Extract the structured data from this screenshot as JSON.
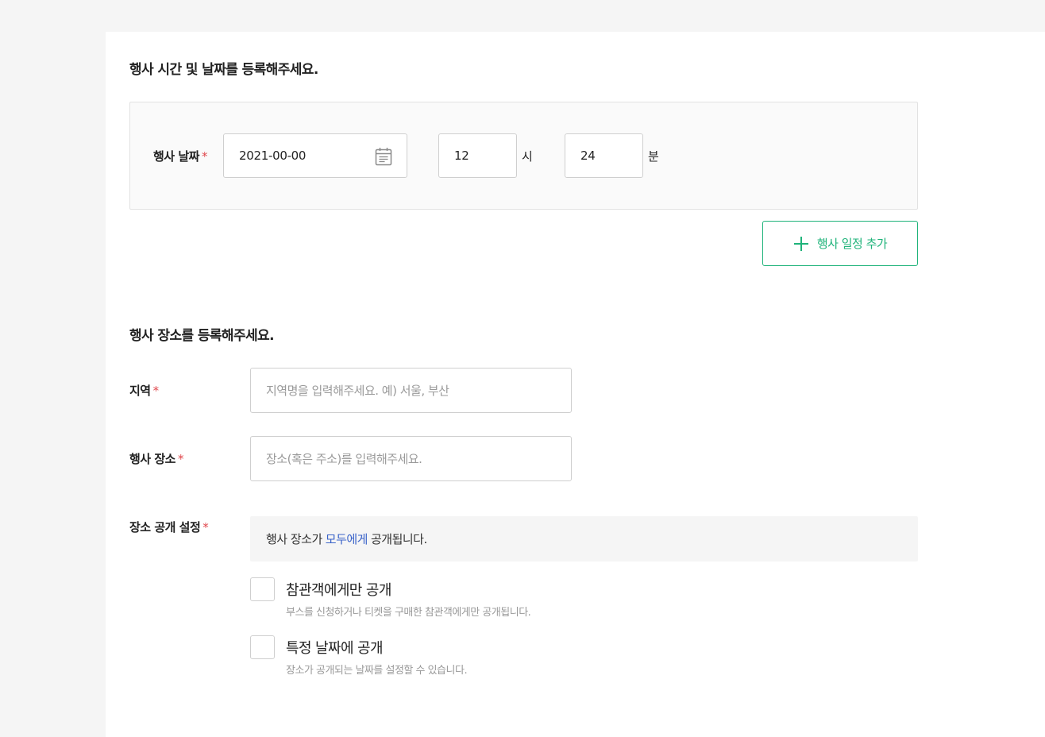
{
  "schedule": {
    "title": "행사 시간 및 날짜를 등록해주세요.",
    "date_label": "행사 날짜",
    "required_mark": "*",
    "date_value": "2021-00-00",
    "hour_value": "12",
    "hour_unit": "시",
    "minute_value": "24",
    "minute_unit": "분",
    "add_button_label": "행사 일정 추가"
  },
  "venue": {
    "title": "행사 장소를 등록해주세요.",
    "region_label": "지역",
    "region_placeholder": "지역명을 입력해주세요. 예) 서울, 부산",
    "place_label": "행사 장소",
    "place_placeholder": "장소(혹은 주소)를 입력해주세요.",
    "visibility_label": "장소 공개 설정",
    "notice_prefix": "행사 장소가",
    "notice_highlight": "모두에게",
    "notice_suffix": "공개됩니다.",
    "options": [
      {
        "title": "참관객에게만 공개",
        "desc": "부스를 신청하거나 티켓을 구매한 참관객에게만 공개됩니다.",
        "checked": false
      },
      {
        "title": "특정 날짜에 공개",
        "desc": "장소가 공개되는 날짜를 설정할 수 있습니다.",
        "checked": false
      }
    ]
  },
  "colors": {
    "accent_green": "#1fb37a",
    "required_red": "#e0474c",
    "highlight_blue": "#3a63c9"
  },
  "icons": {
    "calendar": "calendar-icon",
    "plus": "plus-icon"
  }
}
